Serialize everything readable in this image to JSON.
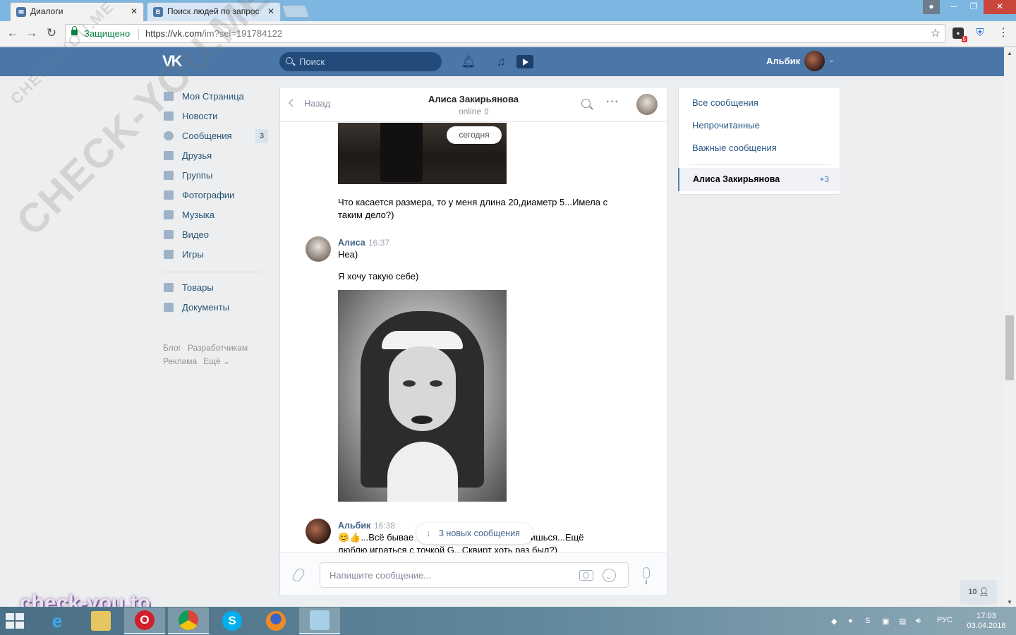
{
  "browser": {
    "tabs": [
      {
        "title": "Диалоги",
        "active": true
      },
      {
        "title": "Поиск людей по запрос",
        "active": false
      }
    ],
    "secure_label": "Защищено",
    "url_host": "https://vk.com",
    "url_path": "/im?sel=191784122",
    "ext_badge": "5"
  },
  "vk_header": {
    "logo": "VK",
    "search_placeholder": "Поиск",
    "user_name": "Альбик"
  },
  "left_menu": {
    "items": [
      {
        "label": "Моя Страница",
        "icon": "home-icon"
      },
      {
        "label": "Новости",
        "icon": "news-icon"
      },
      {
        "label": "Сообщения",
        "icon": "messages-icon",
        "count": "3"
      },
      {
        "label": "Друзья",
        "icon": "friends-icon"
      },
      {
        "label": "Группы",
        "icon": "groups-icon"
      },
      {
        "label": "Фотографии",
        "icon": "camera-icon"
      },
      {
        "label": "Музыка",
        "icon": "music-icon"
      },
      {
        "label": "Видео",
        "icon": "video-icon"
      },
      {
        "label": "Игры",
        "icon": "gamepad-icon"
      }
    ],
    "extra_items": [
      {
        "label": "Товары",
        "icon": "bag-icon"
      },
      {
        "label": "Документы",
        "icon": "document-icon"
      }
    ],
    "footer": [
      "Блог",
      "Разработчикам",
      "Реклама",
      "Ещё ⌄"
    ]
  },
  "chat": {
    "back_label": "Назад",
    "peer_name": "Алиса Закирьянова",
    "peer_status": "online",
    "date_divider": "сегодня",
    "messages": [
      {
        "text": "Что касается размера, то у меня длина 20,диаметр 5...Имела с таким дело?)"
      },
      {
        "author": "Алиса",
        "time": "16:37",
        "lines": [
          "Неа)",
          "Я хочу такую себе)"
        ]
      },
      {
        "author": "Альбик",
        "time": "16:38",
        "text_a": "😊👍...Всё бывае",
        "text_b": "ишься...Ещё",
        "text_c": "люблю играться с точкой G...Сквирт хоть раз был?)"
      }
    ],
    "new_messages_label": "3 новых сообщения",
    "composer_placeholder": "Напишите сообщение..."
  },
  "right_panel": {
    "filters": [
      "Все сообщения",
      "Непрочитанные",
      "Важные сообщения"
    ],
    "active_dialog": {
      "name": "Алиса Закирьянова",
      "count": "+3"
    }
  },
  "online_friends": "10",
  "watermark": {
    "logo_text": "check-you.to",
    "diagonal_1": "CHECK-YOU.ME",
    "diagonal_2": "CHECK-YOU.ME"
  },
  "taskbar": {
    "lang": "РУС",
    "time": "17:03",
    "date": "03.04.2018"
  }
}
